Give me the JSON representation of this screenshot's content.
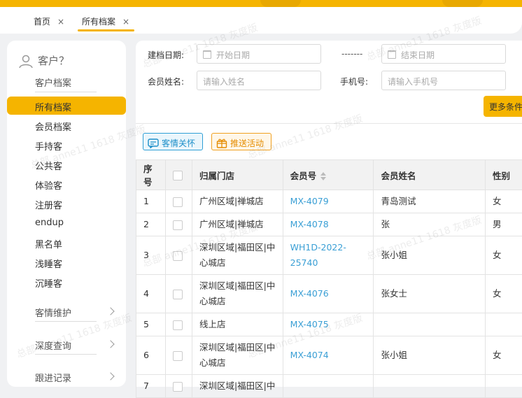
{
  "tabs": [
    {
      "label": "首页",
      "close": "×"
    },
    {
      "label": "所有档案",
      "close": "×"
    }
  ],
  "sidebar": {
    "user_label": "客户？",
    "section_title": "客户档案",
    "items": [
      {
        "label": "所有档案"
      },
      {
        "label": "会员档案"
      },
      {
        "label": "手持客"
      },
      {
        "label": "公共客"
      },
      {
        "label": "体验客"
      },
      {
        "label": "注册客"
      },
      {
        "label": "endup"
      },
      {
        "label": "黑名单"
      },
      {
        "label": "浅睡客"
      },
      {
        "label": "沉睡客"
      }
    ],
    "groups": [
      {
        "label": "客情维护"
      },
      {
        "label": "深度查询"
      },
      {
        "label": "跟进记录"
      }
    ]
  },
  "filters": {
    "date_label": "建档日期:",
    "start_placeholder": "开始日期",
    "range_sep": "-------",
    "end_placeholder": "结束日期",
    "name_label": "会员姓名:",
    "name_placeholder": "请输入姓名",
    "phone_label": "手机号:",
    "phone_placeholder": "请输入手机号",
    "more_button": "更多条件"
  },
  "actions": {
    "care_button": "客情关怀",
    "push_button": "推送活动"
  },
  "table": {
    "headers": [
      "序号",
      "",
      "归属门店",
      "会员号",
      "会员姓名",
      "性别"
    ],
    "rows": [
      {
        "index": "1",
        "store": "广州区域|禅城店",
        "member_no": "MX-4079",
        "name": "青岛测试",
        "gender": "女"
      },
      {
        "index": "2",
        "store": "广州区域|禅城店",
        "member_no": "MX-4078",
        "name": "张",
        "gender": "男"
      },
      {
        "index": "3",
        "store": "深圳区域|福田区|中心城店",
        "member_no": "WH1D-2022-25740",
        "name": "张小姐",
        "gender": "女"
      },
      {
        "index": "4",
        "store": "深圳区域|福田区|中心城店",
        "member_no": "MX-4076",
        "name": "张女士",
        "gender": "女"
      },
      {
        "index": "5",
        "store": "线上店",
        "member_no": "MX-4075",
        "name": "",
        "gender": ""
      },
      {
        "index": "6",
        "store": "深圳区域|福田区|中心城店",
        "member_no": "MX-4074",
        "name": "张小姐",
        "gender": "女"
      },
      {
        "index": "7",
        "store": "深圳区域|福田区|中",
        "member_no": "",
        "name": "",
        "gender": ""
      }
    ]
  },
  "watermark": "总部 anne11 1618 灰度版"
}
